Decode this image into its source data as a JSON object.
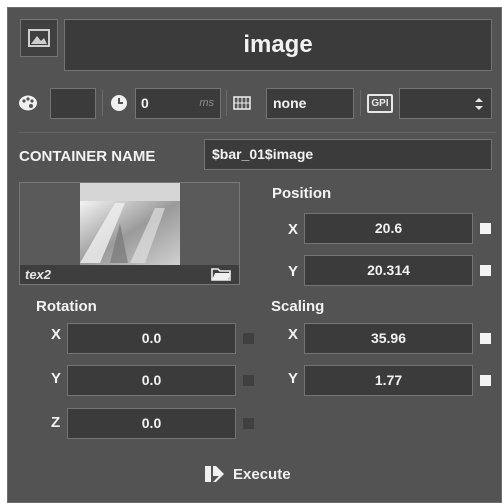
{
  "header": {
    "title": "image",
    "image_icon": "image-icon"
  },
  "toolbar": {
    "color_icon": "palette-icon",
    "time_icon": "clock-icon",
    "time_value": "0",
    "time_unit": "ms",
    "format_icon": "grid-icon",
    "format_value": "none",
    "gpi_icon": "gpi-icon",
    "gpi_label": "GPI",
    "dropdown_arrow": "up-down-arrow-icon"
  },
  "container": {
    "label": "CONTAINER NAME",
    "value": "$bar_01$image"
  },
  "texture": {
    "name": "tex2",
    "folder_icon": "folder-icon"
  },
  "position": {
    "title": "Position",
    "x_label": "X",
    "x_value": "20.6",
    "y_label": "Y",
    "y_value": "20.314"
  },
  "rotation": {
    "title": "Rotation",
    "x_label": "X",
    "x_value": "0.0",
    "y_label": "Y",
    "y_value": "0.0",
    "z_label": "Z",
    "z_value": "0.0"
  },
  "scaling": {
    "title": "Scaling",
    "x_label": "X",
    "x_value": "35.96",
    "y_label": "Y",
    "y_value": "1.77"
  },
  "execute": {
    "label": "Execute",
    "icon": "execute-icon"
  },
  "colors": {
    "panel": "#535353",
    "field": "#3b3b3b",
    "border": "#747474",
    "text": "#f2f2f2"
  }
}
